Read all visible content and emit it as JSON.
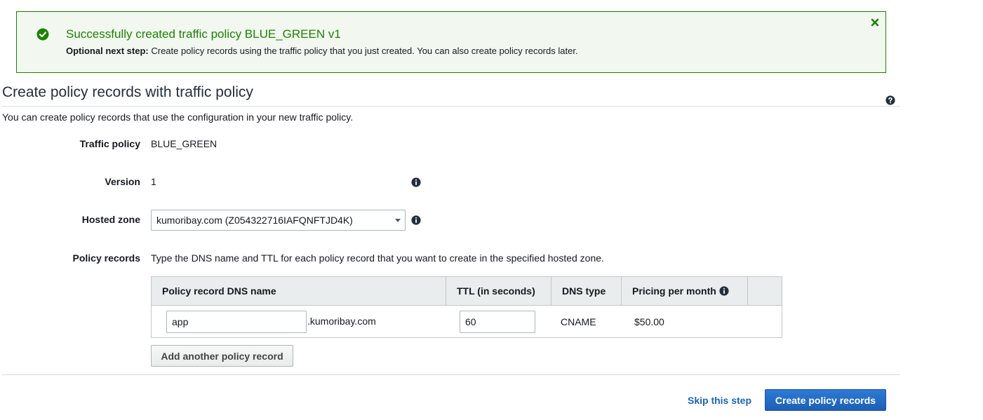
{
  "flash": {
    "icon": "check-circle-icon",
    "title": "Successfully created traffic policy BLUE_GREEN v1",
    "next_step_label": "Optional next step:",
    "next_step_text": " Create policy records using the traffic policy that you just created. You can also create policy records later.",
    "close_icon": "close-icon",
    "color": "#1d8102"
  },
  "page": {
    "title": "Create policy records with traffic policy",
    "help_icon": "help-icon",
    "intro": "You can create policy records that use the configuration in your new traffic policy."
  },
  "form": {
    "traffic_policy": {
      "label": "Traffic policy",
      "value": "BLUE_GREEN"
    },
    "version": {
      "label": "Version",
      "value": "1"
    },
    "hosted_zone": {
      "label": "Hosted zone",
      "selected": "kumoribay.com (Z054322716IAFQNFTJD4K)"
    },
    "policy_records": {
      "label": "Policy records",
      "description": "Type the DNS name and TTL for each policy record that you want to create in the specified hosted zone."
    }
  },
  "table": {
    "headers": [
      "Policy record DNS name",
      "TTL (in seconds)",
      "DNS type",
      "Pricing per month"
    ],
    "rows": [
      {
        "dns_name": "app",
        "domain_suffix": ".kumoribay.com",
        "ttl": "60",
        "dns_type": "CNAME",
        "price": "$50.00"
      }
    ]
  },
  "buttons": {
    "add_record": "Add another policy record",
    "skip": "Skip this step",
    "create": "Create policy records"
  },
  "colors": {
    "primary": "#1d5fb5",
    "link": "#1a66b8",
    "success": "#1d8102"
  }
}
